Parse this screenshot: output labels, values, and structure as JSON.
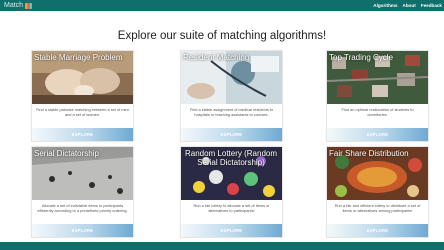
{
  "navbar": {
    "brand": "Match",
    "links": [
      "Algorithms",
      "About",
      "Feedback"
    ]
  },
  "title": "Explore our suite of matching algorithms!",
  "cards": [
    {
      "label": "Stable Marriage Problem",
      "description": "Find a stable pairwise matching between a set of men and a set of women.",
      "button": "EXPLORE"
    },
    {
      "label": "Resident Matching",
      "description": "Find a stable assignment of medical residents to hospitals or teaching assistants to courses.",
      "button": "EXPLORE"
    },
    {
      "label": "Top Trading Cycle",
      "description": "Find an optimal reallocation of students to dormitories.",
      "button": "EXPLORE"
    },
    {
      "label": "Serial Dictatorship",
      "description": "Allocate a set of indivisible items to participants efficiently according to a predefined priority ordering.",
      "button": "EXPLORE"
    },
    {
      "label": "Random Lottery (Random Serial Dictatorship)",
      "description": "Run a fair lottery to allocate a set of items or alternatives to participants!",
      "button": "EXPLORE"
    },
    {
      "label": "Fair Share Distribution",
      "description": "Run a fair and efficient lottery to distribute a set of items or alternatives among participants!",
      "button": "EXPLORE"
    }
  ],
  "colors": {
    "navbar": "#0f6f6a",
    "button_end": "#6fa9d3"
  }
}
